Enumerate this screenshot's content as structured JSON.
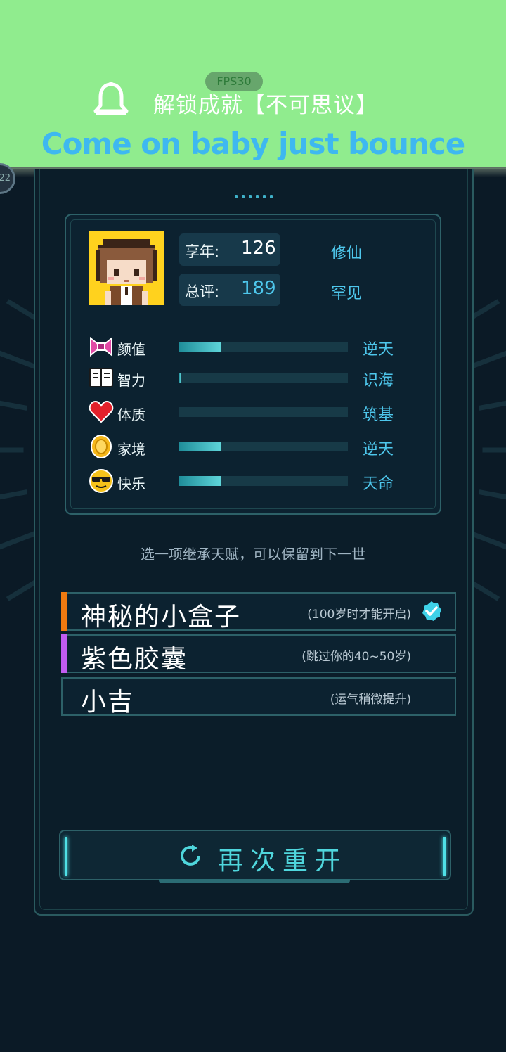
{
  "notification": {
    "fps_label": "FPS30",
    "achievement": "解锁成就【不可思议】",
    "lyric": "Come on baby just bounce",
    "side_bubble_text": "22",
    "icon": "bell-icon"
  },
  "summary": {
    "age_label": "享年:",
    "age_value": "126",
    "age_rank": "修仙",
    "score_label": "总评:",
    "score_value": "189",
    "score_rank": "罕见"
  },
  "attributes": [
    {
      "label": "颜值",
      "icon": "bow-icon",
      "fill_fraction": 0.25,
      "grade": "逆天"
    },
    {
      "label": "智力",
      "icon": "book-icon",
      "fill_fraction": 0.01,
      "grade": "识海"
    },
    {
      "label": "体质",
      "icon": "heart-icon",
      "fill_fraction": 0.0,
      "grade": "筑基"
    },
    {
      "label": "家境",
      "icon": "coin-icon",
      "fill_fraction": 0.25,
      "grade": "逆天"
    },
    {
      "label": "快乐",
      "icon": "sunglasses-face-icon",
      "fill_fraction": 0.25,
      "grade": "天命"
    }
  ],
  "hint": "选一项继承天赋，可以保留到下一世",
  "talents": [
    {
      "name": "神秘的小盒子",
      "desc": "(100岁时才能开启)",
      "color": "#f07a10",
      "selected": true
    },
    {
      "name": "紫色胶囊",
      "desc": "(跳过你的40~50岁)",
      "color": "#c25cf0",
      "selected": false
    },
    {
      "name": "小吉",
      "desc": "(运气稍微提升)",
      "color": "",
      "selected": false
    }
  ],
  "restart_label": "再次重开",
  "colors": {
    "banner": "#90ec8e",
    "accent": "#4ec7ec",
    "panel": "#0b1d29"
  }
}
